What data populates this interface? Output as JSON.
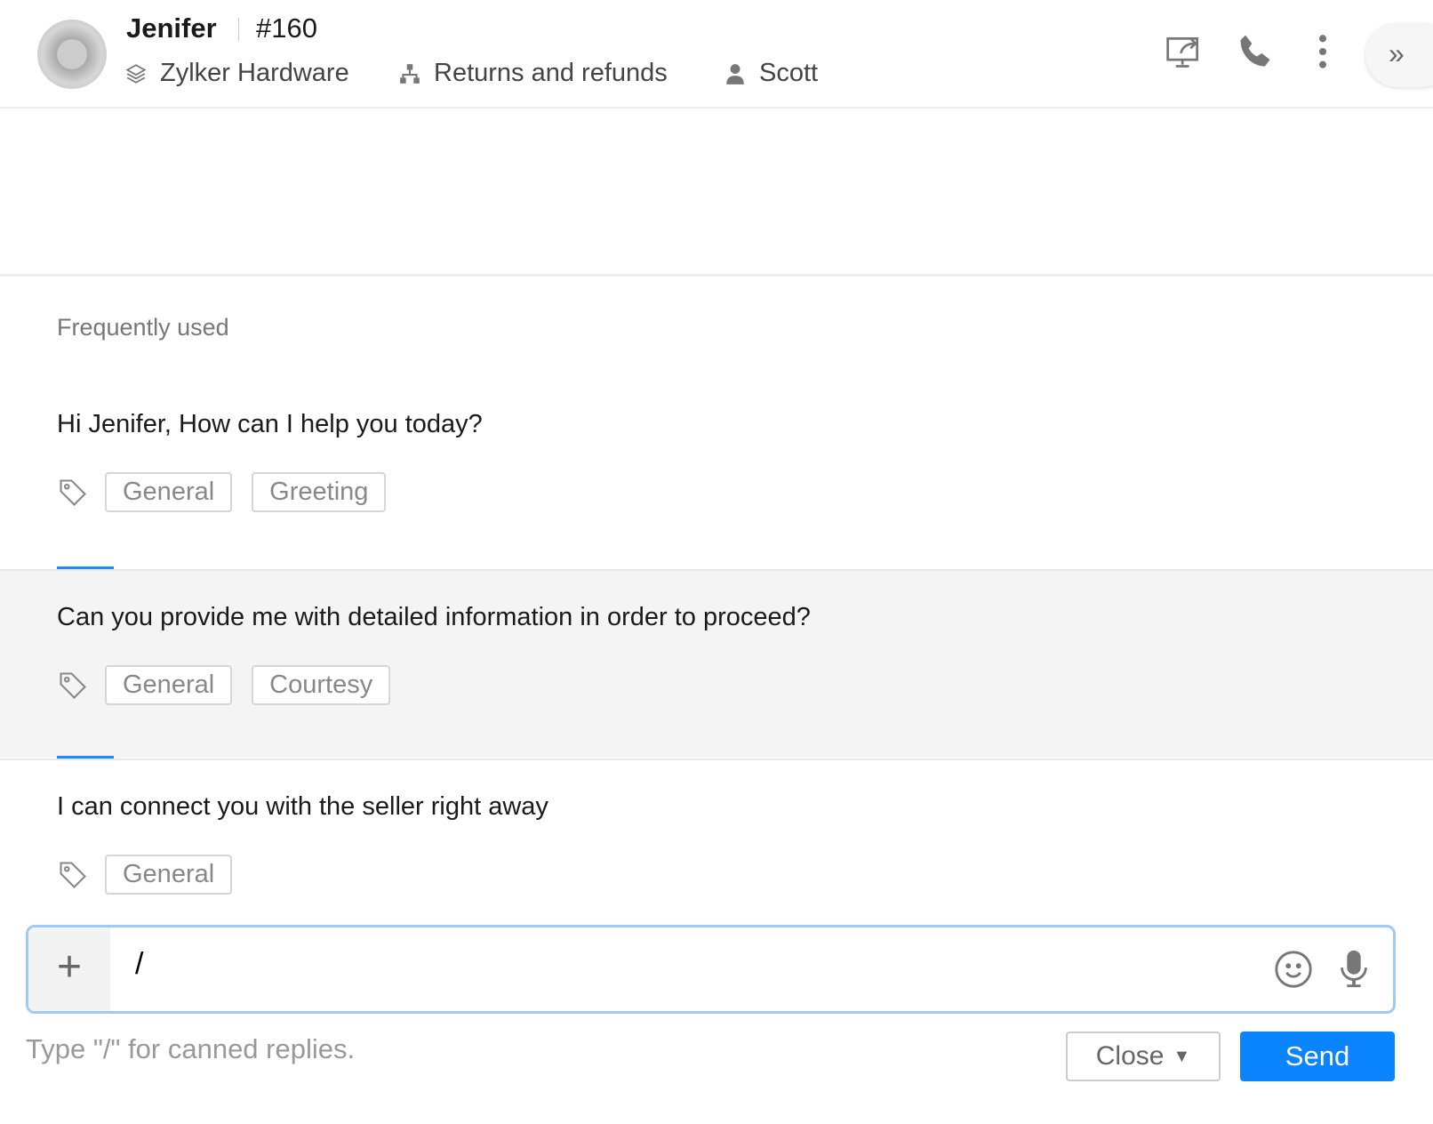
{
  "header": {
    "contact_name": "Jenifer",
    "ticket_id": "#160",
    "brand": "Zylker Hardware",
    "department": "Returns and refunds",
    "agent": "Scott"
  },
  "canned": {
    "section_title": "Frequently used",
    "items": [
      {
        "text": "Hi Jenifer, How can I help you today?",
        "tags": [
          "General",
          "Greeting"
        ]
      },
      {
        "text": "Can you provide me with detailed information in order to proceed?",
        "tags": [
          "General",
          "Courtesy"
        ]
      },
      {
        "text": "I can connect you with the seller right away",
        "tags": [
          "General"
        ]
      }
    ]
  },
  "composer": {
    "value": "/",
    "hint": "Type \"/\" for canned replies.",
    "close_label": "Close",
    "send_label": "Send"
  },
  "colors": {
    "accent": "#0a84ff",
    "focus_border": "#9fcaf8"
  }
}
